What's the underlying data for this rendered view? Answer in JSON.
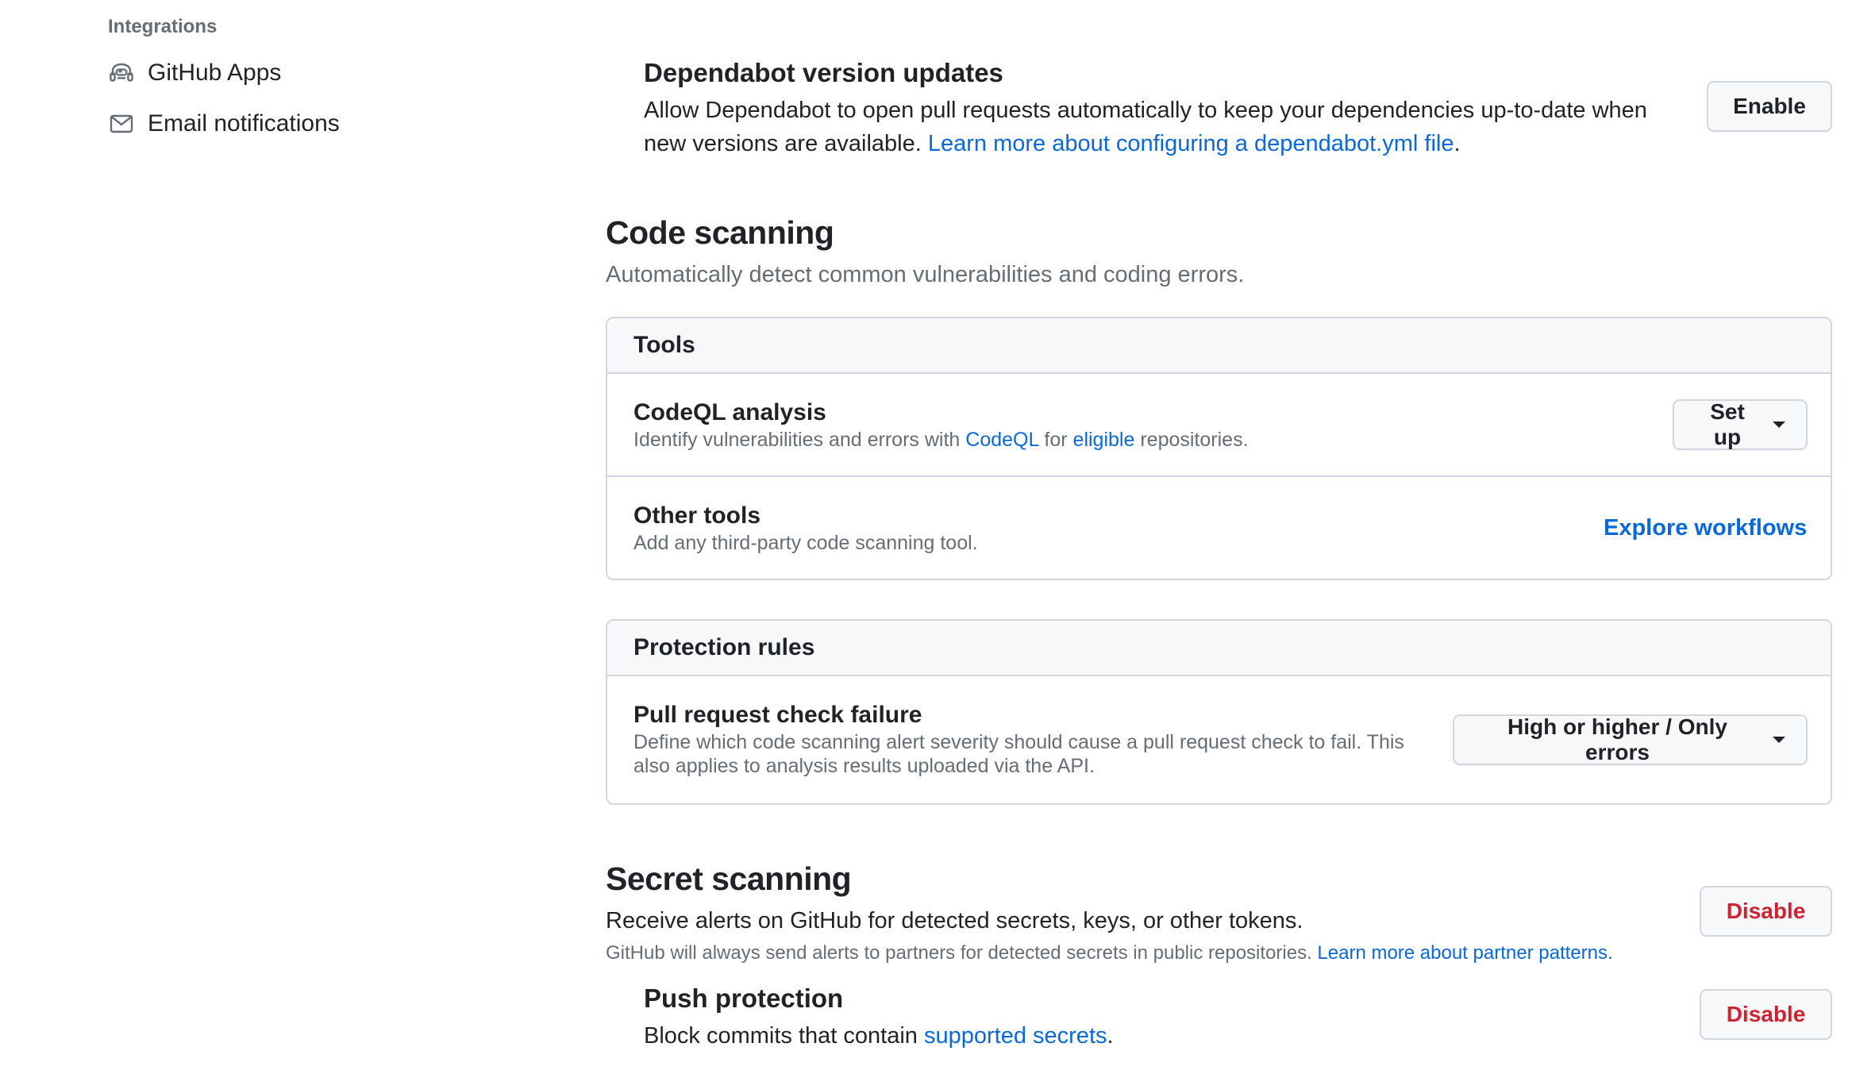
{
  "sidebar": {
    "heading": "Integrations",
    "items": [
      {
        "label": "GitHub Apps",
        "icon": "github-apps-icon"
      },
      {
        "label": "Email notifications",
        "icon": "mail-icon"
      }
    ]
  },
  "dependabot_updates": {
    "title": "Dependabot version updates",
    "description": "Allow Dependabot to open pull requests automatically to keep your dependencies up-to-date when new versions are available.",
    "link": "Learn more about configuring a dependabot.yml file",
    "link_suffix": ".",
    "button": "Enable"
  },
  "code_scanning": {
    "title": "Code scanning",
    "description": "Automatically detect common vulnerabilities and coding errors.",
    "tools_box": {
      "header": "Tools",
      "codeql": {
        "title": "CodeQL analysis",
        "desc_prefix": "Identify vulnerabilities and errors with",
        "link1": "CodeQL",
        "desc_mid": "for",
        "link2": "eligible",
        "desc_suffix": "repositories.",
        "button": "Set up"
      },
      "other": {
        "title": "Other tools",
        "description": "Add any third-party code scanning tool.",
        "link": "Explore workflows"
      }
    },
    "protection_box": {
      "header": "Protection rules",
      "pr_check": {
        "title": "Pull request check failure",
        "description_line1": "Define which code scanning alert severity should cause a pull request check to fail. This",
        "description_line2": "also applies to analysis results uploaded via the API.",
        "select_value": "High or higher / Only errors"
      }
    }
  },
  "secret_scanning": {
    "title": "Secret scanning",
    "description": "Receive alerts on GitHub for detected secrets, keys, or other tokens.",
    "note": "GitHub will always send alerts to partners for detected secrets in public repositories.",
    "note_link": "Learn more about partner patterns.",
    "button": "Disable",
    "push_protection": {
      "title": "Push protection",
      "desc_prefix": "Block commits that contain",
      "link": "supported secrets",
      "desc_suffix": ".",
      "button": "Disable"
    }
  },
  "colors": {
    "link": "#0969da",
    "danger": "#cf222e",
    "border": "#d0d7de",
    "muted": "#656d76"
  }
}
